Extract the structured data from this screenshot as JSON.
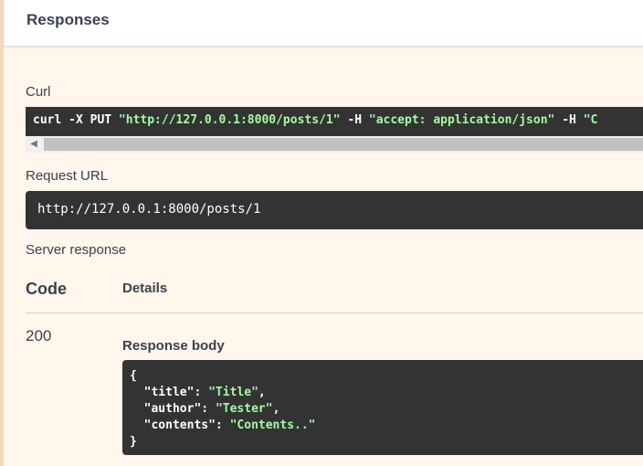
{
  "header": {
    "title": "Responses"
  },
  "curl": {
    "label": "Curl",
    "cmd_1": "curl -X PUT ",
    "url": "\"http://127.0.0.1:8000/posts/1\"",
    "flag_1": " -H  ",
    "accept": "\"accept: application/json\"",
    "flag_2": " -H  ",
    "content_type_start": "\"C"
  },
  "request_url": {
    "label": "Request URL",
    "value": "http://127.0.0.1:8000/posts/1"
  },
  "server_response": {
    "label": "Server response",
    "code_header": "Code",
    "details_header": "Details",
    "code": "200",
    "body_label": "Response body",
    "body": {
      "open": "{",
      "k1": "\"title\"",
      "v1": "\"Title\"",
      "k2": "\"author\"",
      "v2": "\"Tester\"",
      "k3": "\"contents\"",
      "v3": "\"Contents..\"",
      "close": "}"
    }
  },
  "colors": {
    "background": "#fff6ec",
    "code_bg": "#333333",
    "string": "#a2fca2"
  },
  "icons": {
    "scroll_left": "scroll-left-arrow-icon"
  }
}
